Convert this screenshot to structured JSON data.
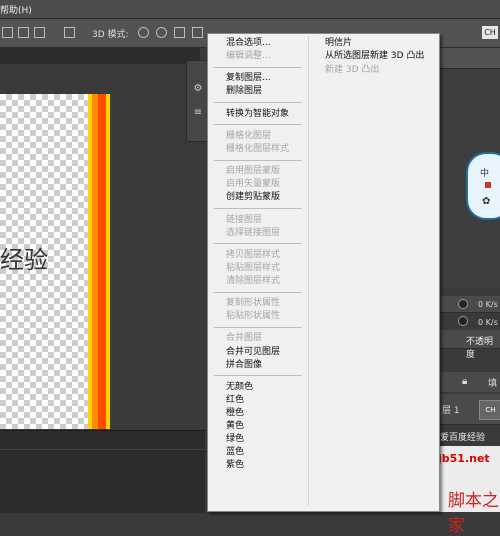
{
  "menubar": {
    "help_label": "帮助(H)"
  },
  "options_bar": {
    "mode_3d_label": "3D 模式:",
    "workspace_badge": "CH"
  },
  "canvas": {
    "text": "经验"
  },
  "context_menu": {
    "col1": [
      {
        "label": "混合选项...",
        "disabled": false
      },
      {
        "label": "编辑调整...",
        "disabled": true
      },
      {
        "sep": true
      },
      {
        "label": "复制图层...",
        "disabled": false
      },
      {
        "label": "删除图层",
        "disabled": false
      },
      {
        "sep": true
      },
      {
        "label": "转换为智能对象",
        "disabled": false
      },
      {
        "sep": true
      },
      {
        "label": "栅格化图层",
        "disabled": true
      },
      {
        "label": "栅格化图层样式",
        "disabled": true
      },
      {
        "sep": true
      },
      {
        "label": "启用图层蒙版",
        "disabled": true
      },
      {
        "label": "启用矢量蒙版",
        "disabled": true
      },
      {
        "label": "创建剪贴蒙版",
        "disabled": false
      },
      {
        "sep": true
      },
      {
        "label": "链接图层",
        "disabled": true
      },
      {
        "label": "选择链接图层",
        "disabled": true
      },
      {
        "sep": true
      },
      {
        "label": "拷贝图层样式",
        "disabled": true
      },
      {
        "label": "粘贴图层样式",
        "disabled": true
      },
      {
        "label": "清除图层样式",
        "disabled": true
      },
      {
        "sep": true
      },
      {
        "label": "复制形状属性",
        "disabled": true
      },
      {
        "label": "粘贴形状属性",
        "disabled": true
      },
      {
        "sep": true
      },
      {
        "label": "合并图层",
        "disabled": true
      },
      {
        "label": "合并可见图层",
        "disabled": false
      },
      {
        "label": "拼合图像",
        "disabled": false
      },
      {
        "sep": true
      },
      {
        "label": "无颜色",
        "disabled": false
      },
      {
        "label": "红色",
        "disabled": false
      },
      {
        "label": "橙色",
        "disabled": false
      },
      {
        "label": "黄色",
        "disabled": false
      },
      {
        "label": "绿色",
        "disabled": false
      },
      {
        "label": "蓝色",
        "disabled": false
      },
      {
        "label": "紫色",
        "disabled": false
      }
    ],
    "col2": [
      {
        "label": "明信片",
        "disabled": false
      },
      {
        "label": "从所选图层新建 3D 凸出",
        "disabled": false
      },
      {
        "label": "新建 3D 凸出",
        "disabled": true
      }
    ]
  },
  "right_panel": {
    "badge_char": "中",
    "kbs_values": [
      "0 K/s",
      "0 K/s",
      "0 K/s",
      "0 K/s"
    ],
    "opacity_label": "不透明度",
    "fill_label": "填",
    "layer_num": "层 1",
    "layer_thumb": "CH",
    "baidu_text": "爱百度经验"
  },
  "watermark": {
    "site": "jb51.net",
    "brand": "脚本之家"
  }
}
